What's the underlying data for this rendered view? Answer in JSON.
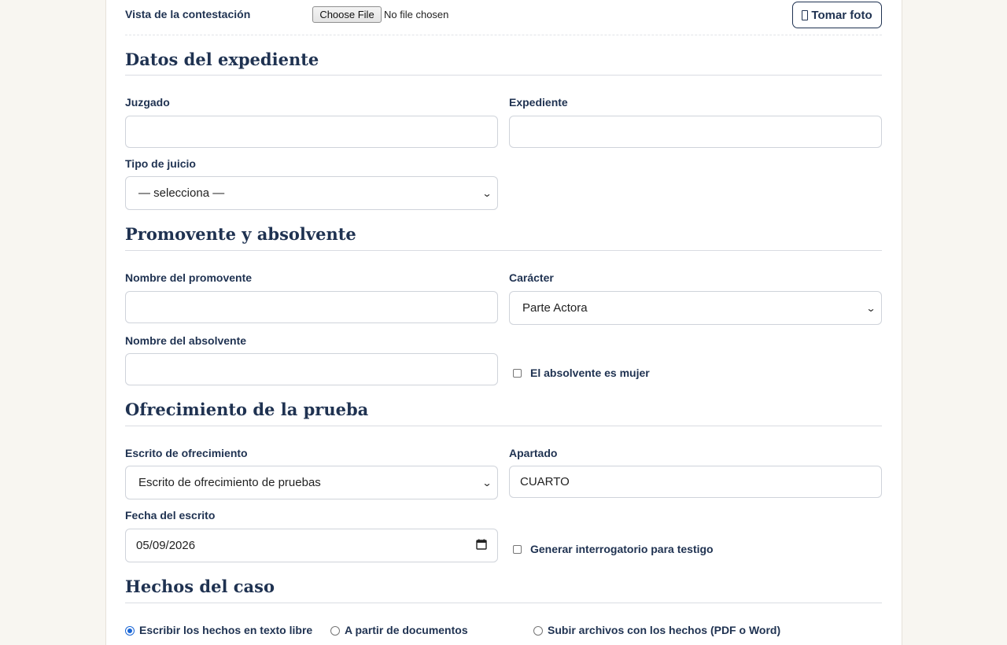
{
  "top": {
    "label": "Vista de la contestación",
    "choose_file": "Choose File",
    "no_file": "No file chosen",
    "photo_button": "Tomar foto",
    "photo_icon": "camera-icon"
  },
  "expediente": {
    "heading": "Datos del expediente",
    "juzgado_label": "Juzgado",
    "juzgado_value": "",
    "expediente_label": "Expediente",
    "expediente_value": "",
    "tipo_label": "Tipo de juicio",
    "tipo_value": "— selecciona —"
  },
  "partes": {
    "heading": "Promovente y absolvente",
    "promovente_label": "Nombre del promovente",
    "promovente_value": "",
    "caracter_label": "Carácter",
    "caracter_value": "Parte Actora",
    "absolvente_label": "Nombre del absolvente",
    "absolvente_value": "",
    "mujer_label": "El absolvente es mujer",
    "mujer_checked": false
  },
  "prueba": {
    "heading": "Ofrecimiento de la prueba",
    "escrito_label": "Escrito de ofrecimiento",
    "escrito_value": "Escrito de ofrecimiento de pruebas",
    "apartado_label": "Apartado",
    "apartado_value": "CUARTO",
    "fecha_label": "Fecha del escrito",
    "fecha_value": "05/09/2026",
    "testigo_label": "Generar interrogatorio para testigo",
    "testigo_checked": false
  },
  "hechos": {
    "heading": "Hechos del caso",
    "options": [
      "Escribir los hechos en texto libre",
      "A partir de documentos",
      "Subir archivos con los hechos (PDF o Word)"
    ],
    "selected": 0
  }
}
